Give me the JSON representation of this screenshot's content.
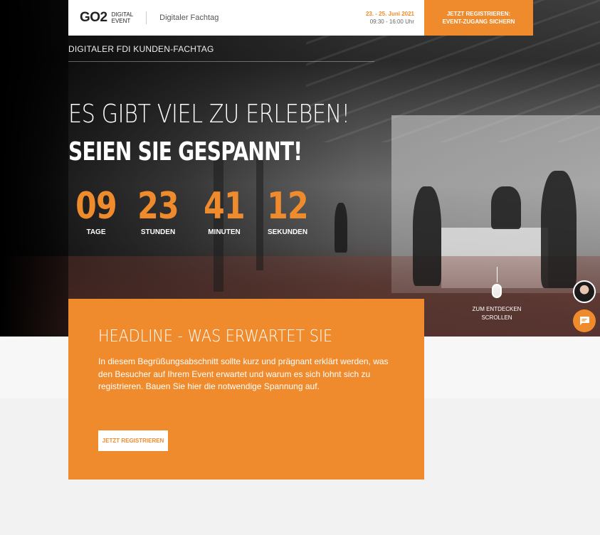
{
  "header": {
    "logo_main": "GO2",
    "logo_sub_1": "DIGITAL",
    "logo_sub_2": "EVENT",
    "event_type": "Digitaler Fachtag",
    "date": "23. - 25. Juni 2021",
    "time": "09:30 - 16:00 Uhr",
    "register_line1": "JETZT REGISTRIEREN:",
    "register_line2": "EVENT-ZUGANG SICHERN"
  },
  "hero": {
    "subtitle": "DIGITALER FDI KUNDEN-FACHTAG",
    "headline_light": "ES GIBT VIEL ZU ERLEBEN!",
    "headline_bold": "SEIEN SIE GESPANNT!"
  },
  "countdown": [
    {
      "value": "09",
      "label": "TAGE"
    },
    {
      "value": "23",
      "label": "STUNDEN"
    },
    {
      "value": "41",
      "label": "MINUTEN"
    },
    {
      "value": "12",
      "label": "SEKUNDEN"
    }
  ],
  "scroll_hint": {
    "line1": "ZUM ENTDECKEN",
    "line2": "SCROLLEN"
  },
  "intro_card": {
    "headline": "HEADLINE - WAS ERWARTET SIE",
    "text": "In diesem Begrüßungsabschnitt sollte kurz und prägnant erklärt werden, was den Besucher auf Ihrem Event erwartet und warum es sich lohnt sich zu registrieren. Bauen Sie hier die notwendige Spannung auf.",
    "button_label": "JETZT REGISTRIEREN"
  },
  "icons": {
    "chat": "chat-bubble-icon",
    "mouse": "mouse-icon",
    "avatar": "avatar"
  },
  "colors": {
    "accent": "#ef8b2c",
    "dark": "#222222"
  }
}
